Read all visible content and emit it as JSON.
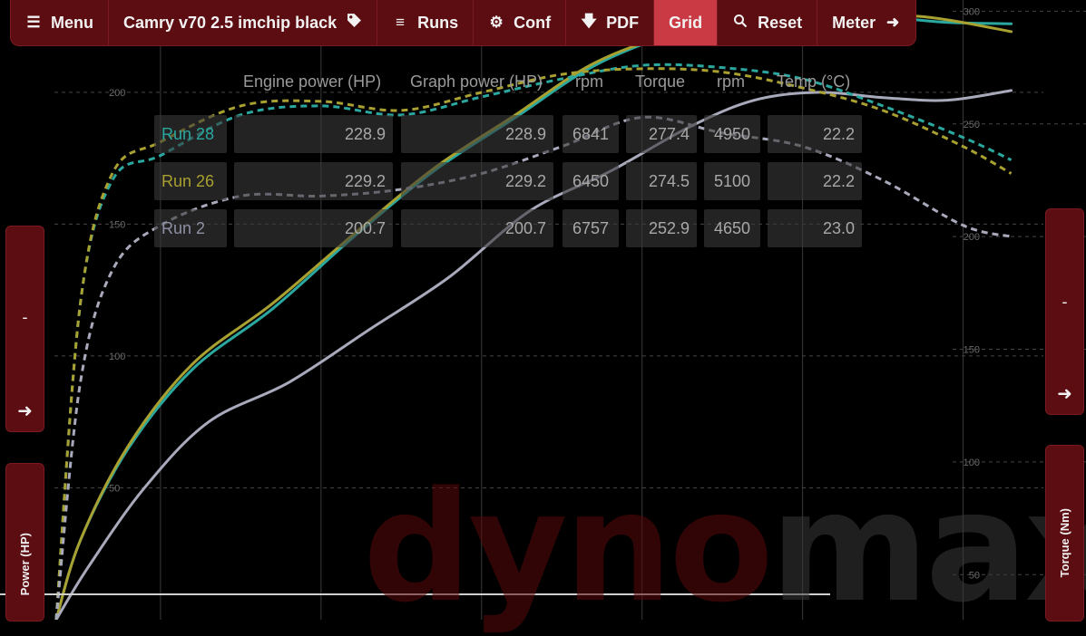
{
  "toolbar": {
    "menu": "Menu",
    "profile": "Camry v70 2.5 imchip black",
    "runs": "Runs",
    "conf": "Conf",
    "pdf": "PDF",
    "grid": "Grid",
    "reset": "Reset",
    "meter": "Meter"
  },
  "icons": {
    "menu": "hamburger-icon",
    "profile": "tag-icon",
    "runs": "list-icon",
    "conf": "gear-icon",
    "pdf": "download-arrow-icon",
    "reset": "search-icon",
    "meter": "arrow-right-icon"
  },
  "colors": {
    "accent": "#c93a44",
    "panel": "#5b0d12",
    "run28": "#2aa8a0",
    "run26": "#a8a030",
    "run2": "#a8aabb"
  },
  "left_tab_top": {
    "minus": "-"
  },
  "left_tab_bottom": {
    "label": "Power (HP)"
  },
  "right_tab_top": {
    "minus": "-"
  },
  "right_tab_bottom": {
    "label": "Torque (Nm)"
  },
  "watermark": {
    "part1": "dyno",
    "part2": "max"
  },
  "table": {
    "headers": [
      "Engine power (HP)",
      "Graph power (HP)",
      "rpm",
      "Torque",
      "rpm",
      "Temp (°C)"
    ],
    "rows": [
      {
        "name": "Run 28",
        "engine_power": "228.9",
        "graph_power": "228.9",
        "rpm1": "6841",
        "torque": "277.4",
        "rpm2": "4950",
        "temp": "22.2"
      },
      {
        "name": "Run 26",
        "engine_power": "229.2",
        "graph_power": "229.2",
        "rpm1": "6450",
        "torque": "274.5",
        "rpm2": "5100",
        "temp": "22.2"
      },
      {
        "name": "Run 2",
        "engine_power": "200.7",
        "graph_power": "200.7",
        "rpm1": "6757",
        "torque": "252.9",
        "rpm2": "4650",
        "temp": "23.0"
      }
    ]
  },
  "chart_data": {
    "type": "line",
    "x_range": [
      1000,
      7500
    ],
    "left_axis": {
      "label": "Power (HP)",
      "ticks": [
        50,
        100,
        150,
        200
      ],
      "range": [
        0,
        235
      ]
    },
    "right_axis": {
      "label": "Torque (Nm)",
      "ticks": [
        50,
        100,
        150,
        200,
        250,
        300
      ],
      "range": [
        30,
        305
      ]
    },
    "grid": true,
    "series": [
      {
        "name": "Run 28",
        "kind": "power",
        "color": "#2aa8a0",
        "x": [
          1350,
          1500,
          1800,
          2200,
          2700,
          3200,
          3700,
          4200,
          4700,
          5200,
          5700,
          6200,
          6600,
          6900,
          7300
        ],
        "y": [
          0,
          30,
          65,
          95,
          118,
          145,
          170,
          190,
          210,
          222,
          227,
          228.9,
          228,
          226.5,
          226
        ]
      },
      {
        "name": "Run 26",
        "kind": "power",
        "color": "#a8a030",
        "x": [
          1350,
          1500,
          1800,
          2200,
          2700,
          3200,
          3700,
          4200,
          4700,
          5200,
          5700,
          6200,
          6600,
          6900,
          7300
        ],
        "y": [
          0,
          30,
          66,
          97,
          120,
          146,
          171,
          191,
          211,
          222,
          226,
          228.5,
          229.2,
          227.5,
          223
        ]
      },
      {
        "name": "Run 2",
        "kind": "power",
        "color": "#a8aabb",
        "x": [
          1350,
          1550,
          1900,
          2300,
          2800,
          3300,
          3800,
          4300,
          4800,
          5300,
          5700,
          6100,
          6500,
          6900,
          7300
        ],
        "y": [
          0,
          20,
          50,
          75,
          90,
          110,
          130,
          155,
          170,
          187,
          197,
          200,
          198,
          197,
          200.7
        ]
      },
      {
        "name": "Run 28",
        "kind": "torque",
        "color": "#2aa8a0",
        "dashed": true,
        "x": [
          1350,
          1500,
          1700,
          2000,
          2500,
          3000,
          3500,
          4000,
          4500,
          5000,
          5500,
          6000,
          6500,
          7000,
          7300
        ],
        "y": [
          30,
          170,
          225,
          236,
          254,
          258,
          254,
          262,
          270,
          276,
          275,
          270,
          258,
          244,
          234
        ]
      },
      {
        "name": "Run 26",
        "kind": "torque",
        "color": "#a8a030",
        "dashed": true,
        "x": [
          1350,
          1500,
          1700,
          2000,
          2500,
          3000,
          3500,
          4000,
          4500,
          5000,
          5500,
          6000,
          6500,
          7000,
          7300
        ],
        "y": [
          30,
          170,
          228,
          242,
          258,
          260,
          256,
          264,
          272,
          274.5,
          273,
          266,
          256,
          240,
          228
        ]
      },
      {
        "name": "Run 2",
        "kind": "torque",
        "color": "#a8aabb",
        "dashed": true,
        "x": [
          1350,
          1500,
          1700,
          2000,
          2500,
          3000,
          3500,
          4000,
          4500,
          5000,
          5500,
          6000,
          6500,
          7000,
          7300
        ],
        "y": [
          30,
          135,
          185,
          205,
          218,
          218,
          221,
          228,
          240,
          252.9,
          246,
          240,
          225,
          205,
          200
        ]
      }
    ]
  }
}
